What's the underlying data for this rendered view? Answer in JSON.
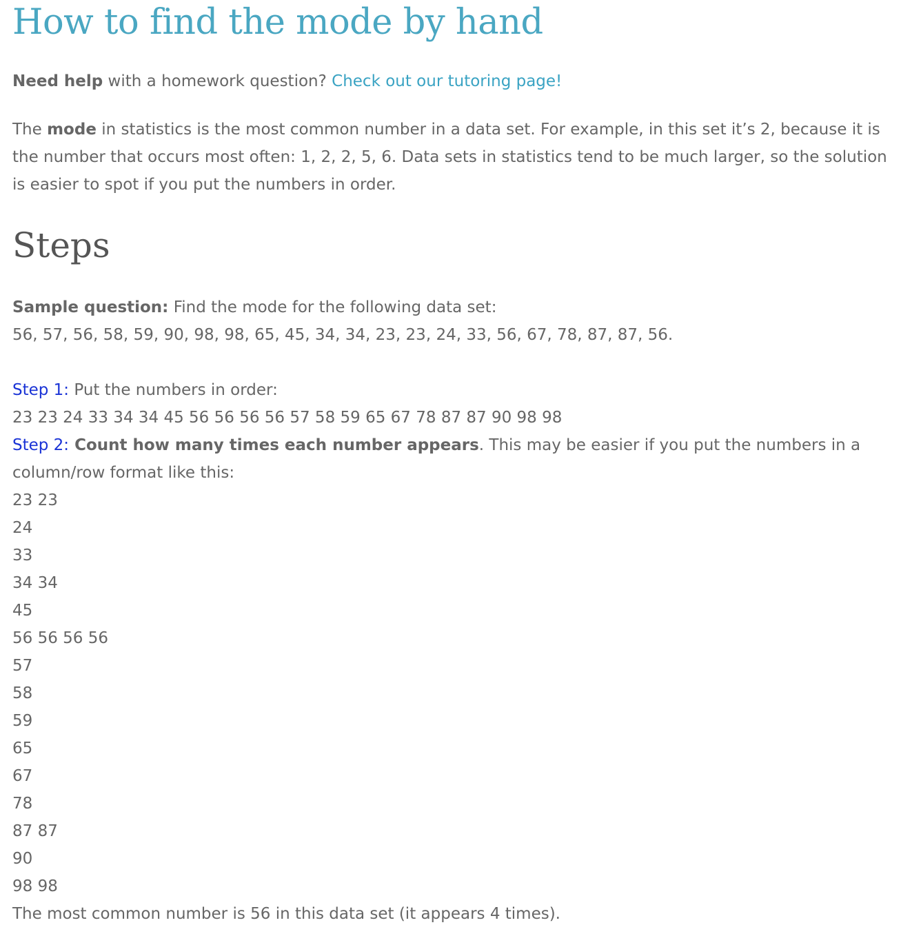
{
  "header": {
    "title": "How to find the mode by hand"
  },
  "help": {
    "bold_text": "Need help",
    "text": " with a homework question? ",
    "link_label": "Check out our tutoring page!"
  },
  "intro": {
    "text_before": "The ",
    "bold_word": "mode",
    "text_after": " in statistics is the most common number in a data set. For example, in this set it’s 2, because it is the number that occurs most often: 1, 2, 2, 5, 6. Data sets in statistics tend to be much larger, so the solution is easier to spot if you put the numbers in order."
  },
  "steps_heading": "Steps",
  "sample": {
    "bold_label": "Sample question:",
    "question": " Find the mode for the following data set:",
    "data_set": "56, 57, 56, 58, 59, 90, 98, 98, 65, 45, 34, 34, 23, 23, 24, 33, 56, 67, 78, 87, 87, 56."
  },
  "step1": {
    "label": "Step 1:",
    "text": " Put the numbers in order:",
    "ordered": "23 23 24 33 34 34 45 56 56 56 56 57 58 59 65 67 78 87 87 90 98 98"
  },
  "step2": {
    "label": "Step 2:",
    "bold_text": " Count how many times each number appears",
    "text": ". This may be easier if you put the numbers in a column/row format like this:",
    "rows": [
      "23 23",
      "24",
      "33",
      "34 34",
      "45",
      "56 56 56 56",
      "57",
      "58",
      "59",
      "65",
      "67",
      "78",
      "87 87",
      "90",
      "98 98"
    ],
    "conclusion": "The most common number is 56 in this data set (it appears 4 times)."
  }
}
